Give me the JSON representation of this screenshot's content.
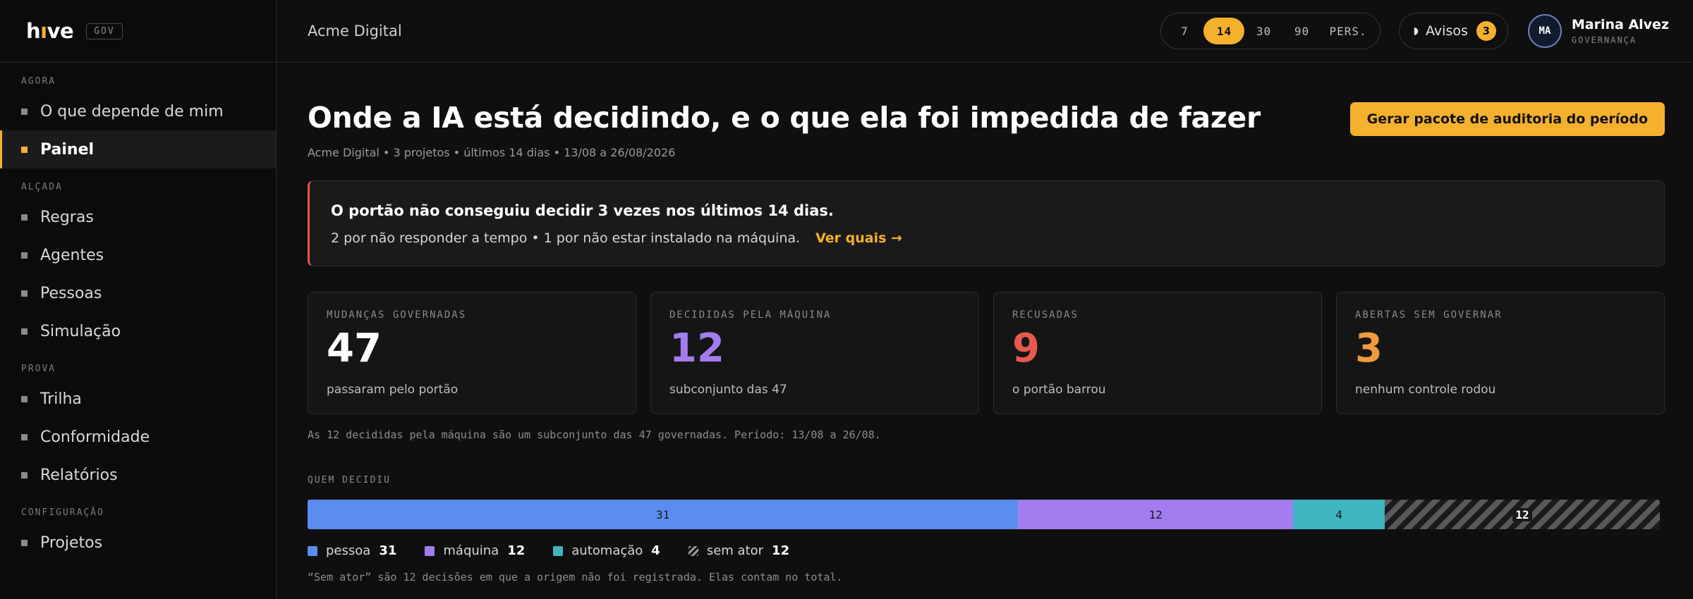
{
  "brand": {
    "logo_text": "hive",
    "tag": "GOV"
  },
  "sidebar": {
    "sections": [
      {
        "title": "AGORA",
        "items": [
          {
            "label": "O que depende de mim"
          },
          {
            "label": "Painel",
            "active": true
          }
        ]
      },
      {
        "title": "ALÇADA",
        "items": [
          {
            "label": "Regras"
          },
          {
            "label": "Agentes"
          },
          {
            "label": "Pessoas"
          },
          {
            "label": "Simulação"
          }
        ]
      },
      {
        "title": "PROVA",
        "items": [
          {
            "label": "Trilha"
          },
          {
            "label": "Conformidade"
          },
          {
            "label": "Relatórios"
          }
        ]
      },
      {
        "title": "CONFIGURAÇÃO",
        "items": [
          {
            "label": "Projetos"
          }
        ]
      }
    ]
  },
  "topbar": {
    "org": "Acme Digital",
    "periods": [
      "7",
      "14",
      "30",
      "90",
      "PERS."
    ],
    "active_period": "14",
    "alerts_label": "Avisos",
    "alerts_count": "3",
    "user": {
      "initials": "MA",
      "name": "Marina Alvez",
      "role": "GOVERNANÇA"
    }
  },
  "page": {
    "title": "Onde a IA está decidindo, e o que ela foi impedida de fazer",
    "subtitle": "Acme Digital • 3 projetos • últimos 14 dias • 13/08 a 26/08/2026",
    "audit_button": "Gerar pacote de auditoria do período"
  },
  "alert": {
    "title": "O portão não conseguiu decidir 3 vezes nos últimos 14 dias.",
    "detail": "2 por não responder a tempo • 1 por não estar instalado na máquina.",
    "link": "Ver quais →"
  },
  "stats": [
    {
      "label": "MUDANÇAS GOVERNADAS",
      "value": "47",
      "desc": "passaram pelo portão",
      "color": "#ffffff"
    },
    {
      "label": "DECIDIDAS PELA MÁQUINA",
      "value": "12",
      "desc": "subconjunto das 47",
      "color": "#a37cf0"
    },
    {
      "label": "RECUSADAS",
      "value": "9",
      "desc": "o portão barrou",
      "color": "#e8594d"
    },
    {
      "label": "ABERTAS SEM GOVERNAR",
      "value": "3",
      "desc": "nenhum controle rodou",
      "color": "#f09a3e"
    }
  ],
  "stats_note": "As 12 decididas pela máquina são um subconjunto das 47 governadas. Período: 13/08 a 26/08.",
  "who_decided": {
    "label": "QUEM DECIDIU",
    "segments": [
      {
        "name": "pessoa",
        "value": 31,
        "color": "#5b8def"
      },
      {
        "name": "máquina",
        "value": 12,
        "color": "#a37cf0"
      },
      {
        "name": "automação",
        "value": 4,
        "color": "#3fb5c1"
      },
      {
        "name": "sem ator",
        "value": 12,
        "color": "hatched"
      }
    ],
    "note": "“Sem ator” são 12 decisões em que a origem não foi registrada. Elas contam no total."
  },
  "chart_data": {
    "type": "bar",
    "title": "QUEM DECIDIU",
    "categories": [
      "pessoa",
      "máquina",
      "automação",
      "sem ator"
    ],
    "values": [
      31,
      12,
      4,
      12
    ]
  }
}
